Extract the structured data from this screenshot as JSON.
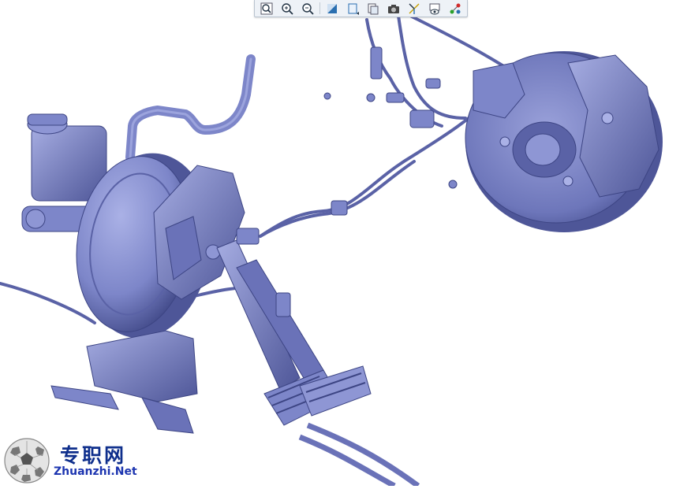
{
  "toolbar": {
    "buttons": [
      {
        "icon": "zoom-fit-icon"
      },
      {
        "icon": "zoom-in-icon"
      },
      {
        "icon": "zoom-out-icon"
      },
      {
        "icon": "shading-icon"
      },
      {
        "icon": "view-orientation-icon"
      },
      {
        "icon": "saved-views-icon"
      },
      {
        "icon": "snapshot-icon"
      },
      {
        "icon": "spin-center-icon"
      },
      {
        "icon": "appearance-icon"
      },
      {
        "icon": "datum-display-icon"
      }
    ]
  },
  "model": {
    "color": "#7d86c9",
    "highlight": "#aab1e6",
    "shadow": "#3d4584"
  },
  "watermark": {
    "brand_cn": "专职网",
    "url": "Zhuanzhi.Net"
  }
}
